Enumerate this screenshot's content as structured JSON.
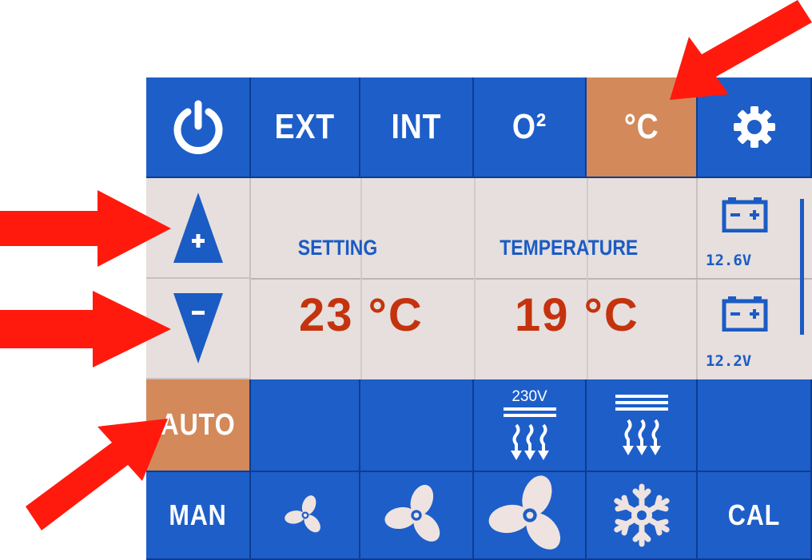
{
  "top_row": {
    "power_icon": "power-icon",
    "ext_label": "EXT",
    "int_label": "INT",
    "o2_label": "O²",
    "celsius_label": "°C",
    "settings_icon": "gear-icon"
  },
  "display": {
    "setting_label": "SETTING",
    "temperature_label": "TEMPERATURE",
    "setting_value": "23 °C",
    "temperature_value": "19 °C"
  },
  "battery": {
    "battery1_voltage": "12.6V",
    "battery2_voltage": "12.2V"
  },
  "mode_row": {
    "auto_label": "AUTO",
    "heater_230v_label": "230V"
  },
  "bottom_row": {
    "man_label": "MAN",
    "cal_label": "CAL"
  },
  "colors": {
    "panel_blue": "#1d5ec9",
    "active_orange": "#d3895a",
    "display_bg": "#e6dfdd",
    "value_red": "#c4330d",
    "pointer_red": "#ff1a0d"
  }
}
